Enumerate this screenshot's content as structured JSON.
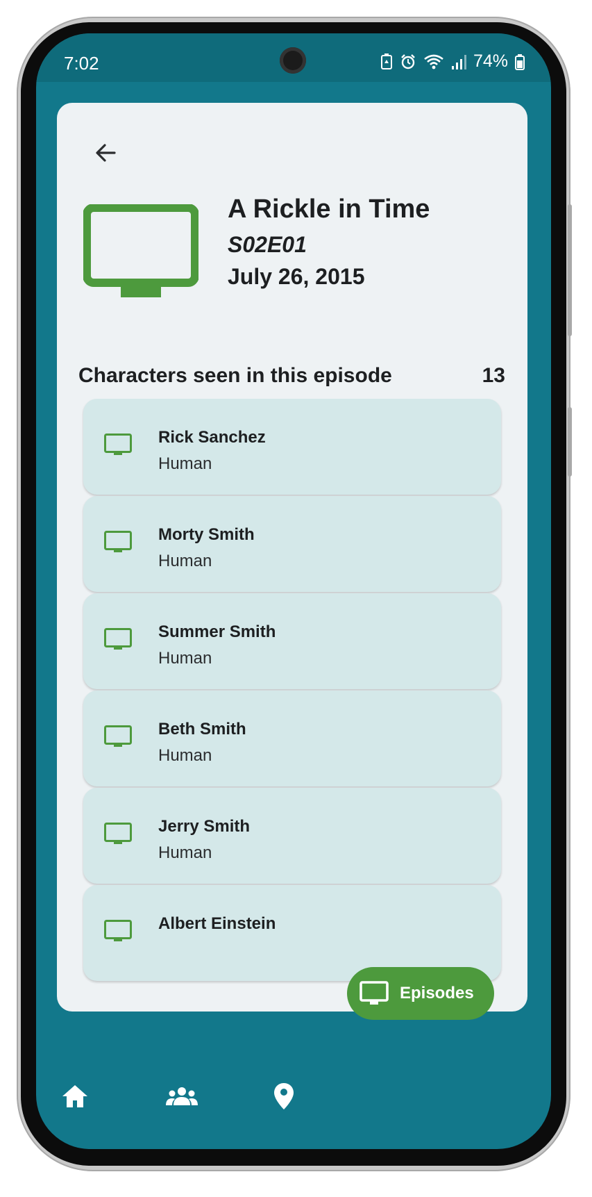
{
  "status_bar": {
    "time": "7:02",
    "battery": "74%",
    "icons": [
      "battery-saver-icon",
      "alarm-icon",
      "wifi-icon",
      "signal-icon",
      "battery-icon"
    ]
  },
  "episode": {
    "title": "A Rickle in Time",
    "code": "S02E01",
    "air_date": "July 26, 2015",
    "icon": "tv-icon"
  },
  "characters_section": {
    "heading": "Characters seen in this episode",
    "count": "13",
    "items": [
      {
        "name": "Rick Sanchez",
        "species": "Human"
      },
      {
        "name": "Morty Smith",
        "species": "Human"
      },
      {
        "name": "Summer Smith",
        "species": "Human"
      },
      {
        "name": "Beth Smith",
        "species": "Human"
      },
      {
        "name": "Jerry Smith",
        "species": "Human"
      },
      {
        "name": "Albert Einstein",
        "species": ""
      }
    ]
  },
  "bottom_nav": {
    "items": [
      {
        "icon": "home-icon"
      },
      {
        "icon": "people-icon"
      },
      {
        "icon": "location-pin-icon"
      },
      {
        "icon": "tv-icon",
        "label": "Episodes",
        "active": true
      }
    ]
  },
  "colors": {
    "screen_bg": "#12788b",
    "status_bg": "#0f6b7b",
    "card_bg": "#eef2f4",
    "item_bg": "#d4e8e9",
    "accent_green": "#4d9a3d",
    "text_dark": "#1d1f21"
  }
}
